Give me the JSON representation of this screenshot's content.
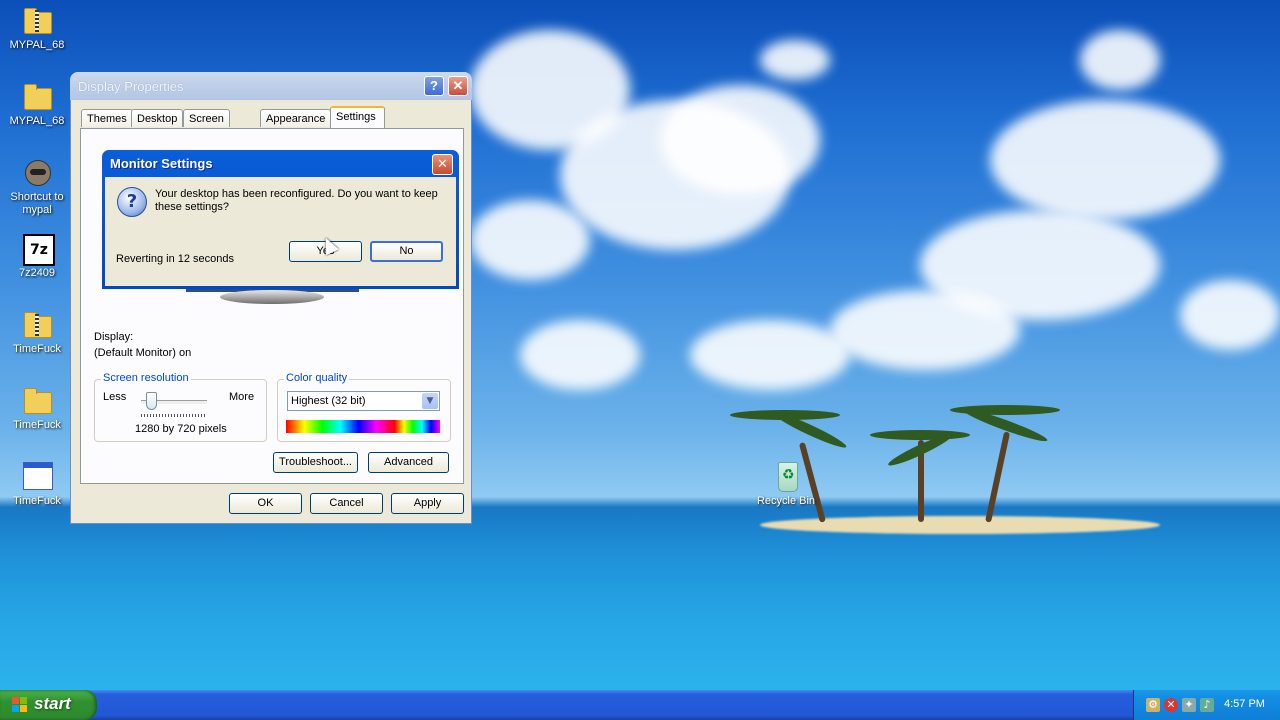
{
  "desktop": {
    "icons": [
      {
        "label": "MYPAL_68",
        "icon": "zip-folder-icon"
      },
      {
        "label": "MYPAL_68",
        "icon": "folder-icon"
      },
      {
        "label": "Shortcut to mypal",
        "icon": "mypal-shortcut-icon"
      },
      {
        "label": "7z2409",
        "icon": "7zip-icon"
      },
      {
        "label": "TimeFuck",
        "icon": "zip-folder-icon"
      },
      {
        "label": "TimeFuck",
        "icon": "folder-icon"
      },
      {
        "label": "TimeFuck",
        "icon": "application-window-icon"
      }
    ],
    "recycle_bin": {
      "label": "Recycle Bin",
      "icon": "recycle-bin-icon"
    }
  },
  "display_properties": {
    "title": "Display Properties",
    "help_glyph": "?",
    "close_glyph": "✕",
    "tabs": [
      {
        "label": "Themes",
        "active": false
      },
      {
        "label": "Desktop",
        "active": false
      },
      {
        "label": "Screen Saver",
        "active": false
      },
      {
        "label": "Appearance",
        "active": false
      },
      {
        "label": "Settings",
        "active": true
      }
    ],
    "display_label": "Display:",
    "display_value": "(Default Monitor) on",
    "screen_resolution": {
      "title": "Screen resolution",
      "less": "Less",
      "more": "More",
      "value_text": "1280 by 720 pixels"
    },
    "color_quality": {
      "title": "Color quality",
      "selected": "Highest (32 bit)"
    },
    "buttons": {
      "troubleshoot": "Troubleshoot...",
      "advanced": "Advanced",
      "ok": "OK",
      "cancel": "Cancel",
      "apply": "Apply"
    }
  },
  "monitor_settings": {
    "title": "Monitor Settings",
    "close_glyph": "✕",
    "question_glyph": "?",
    "message": "Your desktop has been reconfigured.  Do you want to keep these settings?",
    "countdown": "Reverting in 12 seconds",
    "yes": "Yes",
    "no": "No"
  },
  "taskbar": {
    "start_label": "start",
    "clock": "4:57 PM",
    "tray_icons": [
      "network-icon",
      "security-alert-icon",
      "tools-icon",
      "volume-icon"
    ]
  },
  "colors": {
    "xp_title_blue": "#0a5ed8",
    "taskbar_blue": "#245edb",
    "start_green": "#309030",
    "group_title_blue": "#0046d5"
  }
}
